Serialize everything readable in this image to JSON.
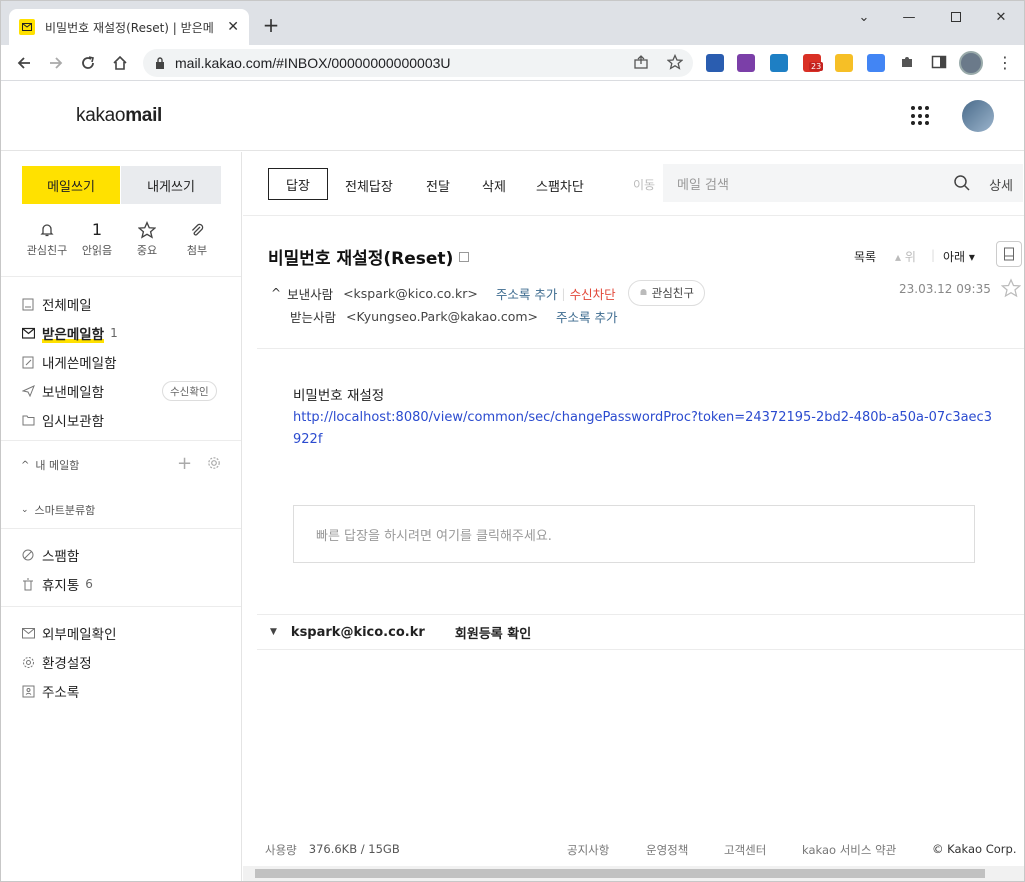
{
  "browser": {
    "tab_title": "비밀번호 재설정(Reset) | 받은메",
    "url": "mail.kakao.com/#INBOX/00000000000003U",
    "gmail_badge": "23"
  },
  "app": {
    "logo_light": "kakao",
    "logo_bold": "mail"
  },
  "sidebar": {
    "compose": "메일쓰기",
    "self_compose": "내게쓰기",
    "quick": [
      {
        "label": "관심친구"
      },
      {
        "value": "1",
        "label": "안읽음"
      },
      {
        "label": "중요"
      },
      {
        "label": "첨부"
      }
    ],
    "mailboxes": [
      {
        "label": "전체메일"
      },
      {
        "label": "받은메일함",
        "count": "1"
      },
      {
        "label": "내게쓴메일함"
      },
      {
        "label": "보낸메일함",
        "badge": "수신확인"
      },
      {
        "label": "임시보관함"
      }
    ],
    "my_mailbox": "내 메일함",
    "smart": "스마트분류함",
    "spam": "스팸함",
    "trash": "휴지통",
    "trash_count": "6",
    "external": "외부메일확인",
    "settings": "환경설정",
    "contacts": "주소록"
  },
  "actions": {
    "reply": "답장",
    "reply_all": "전체답장",
    "forward": "전달",
    "delete": "삭제",
    "block_spam": "스팸차단",
    "move": "이동",
    "search_placeholder": "메일 검색",
    "advanced": "상세"
  },
  "mail": {
    "subject": "비밀번호 재설정(Reset)",
    "list": "목록",
    "up": "위",
    "down": "아래",
    "from_label": "보낸사람",
    "from_addr": "<kspark@kico.co.kr>",
    "add_contact": "주소록 추가",
    "block": "수신차단",
    "vip": "관심친구",
    "to_label": "받는사람",
    "to_addr": "<Kyungseo.Park@kakao.com>",
    "date": "23.03.12 09:35",
    "body_title": "비밀번호 재설정",
    "body_link": "http://localhost:8080/view/common/sec/changePasswordProc?token=24372195-2bd2-480b-a50a-07c3aec3922f",
    "quick_reply": "빠른 답장을 하시려면 여기를 클릭해주세요."
  },
  "thread": {
    "from": "kspark@kico.co.kr",
    "subject": "회원등록 확인"
  },
  "footer": {
    "usage_label": "사용량",
    "usage_value": "376.6KB / 15GB",
    "notice": "공지사항",
    "policy": "운영정책",
    "support": "고객센터",
    "terms": "kakao 서비스 약관",
    "copyright": "© Kakao Corp."
  }
}
